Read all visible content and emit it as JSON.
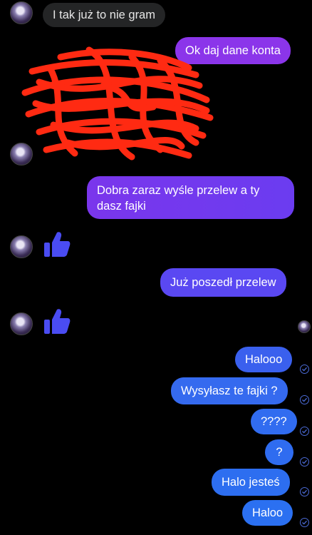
{
  "messages": {
    "m1": "I tak już to nie gram",
    "m2": "Ok daj dane konta",
    "m3_line1": "Dobra zaraz wyśle przelew a ty",
    "m3_line2": "dasz fajki",
    "m4": "Już poszedł przelew",
    "m5": "Halooo",
    "m6": "Wysyłasz te fajki ?",
    "m7": "????",
    "m8": "?",
    "m9": "Halo jesteś",
    "m10": "Haloo"
  },
  "colors": {
    "incoming_bg": "#242526",
    "outgoing_purple": "#8b35ea",
    "outgoing_blue": "#2f6cf0",
    "like": "#4a4cf2",
    "redaction": "#ff2a12"
  },
  "icons": {
    "reaction": "thumbs-up-icon",
    "read_receipt": "check-circle-icon",
    "avatar": "avatar"
  }
}
